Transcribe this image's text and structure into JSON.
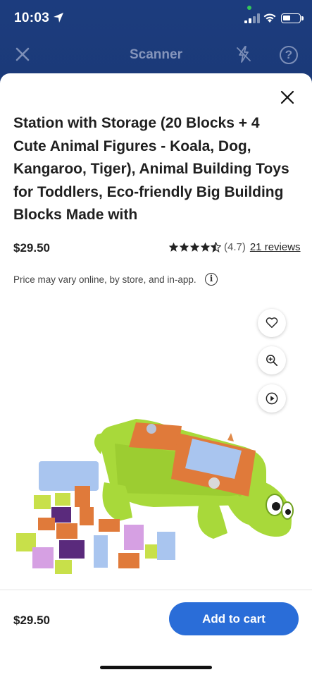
{
  "status_bar": {
    "time": "10:03"
  },
  "nav": {
    "title": "Scanner",
    "help_glyph": "?"
  },
  "product": {
    "title": "Station with Storage (20 Blocks + 4 Cute Animal Figures - Koala, Dog, Kangaroo, Tiger), Animal Building Toys for Toddlers, Eco-friendly Big Building Blocks Made with",
    "price": "$29.50",
    "rating_stars": 4.5,
    "rating_text": "(4.7)",
    "reviews_label": "21 reviews",
    "disclaimer": "Price may vary online, by store, and in-app.",
    "info_glyph": "i"
  },
  "actions": {
    "favorite_icon": "heart-icon",
    "zoom_icon": "zoom-in-icon",
    "video_icon": "play-icon"
  },
  "footer": {
    "price": "$29.50",
    "add_to_cart_label": "Add to cart"
  },
  "colors": {
    "header": "#1c3c7e",
    "accent": "#2a6dd8",
    "crocodile": "#a8d93a"
  }
}
